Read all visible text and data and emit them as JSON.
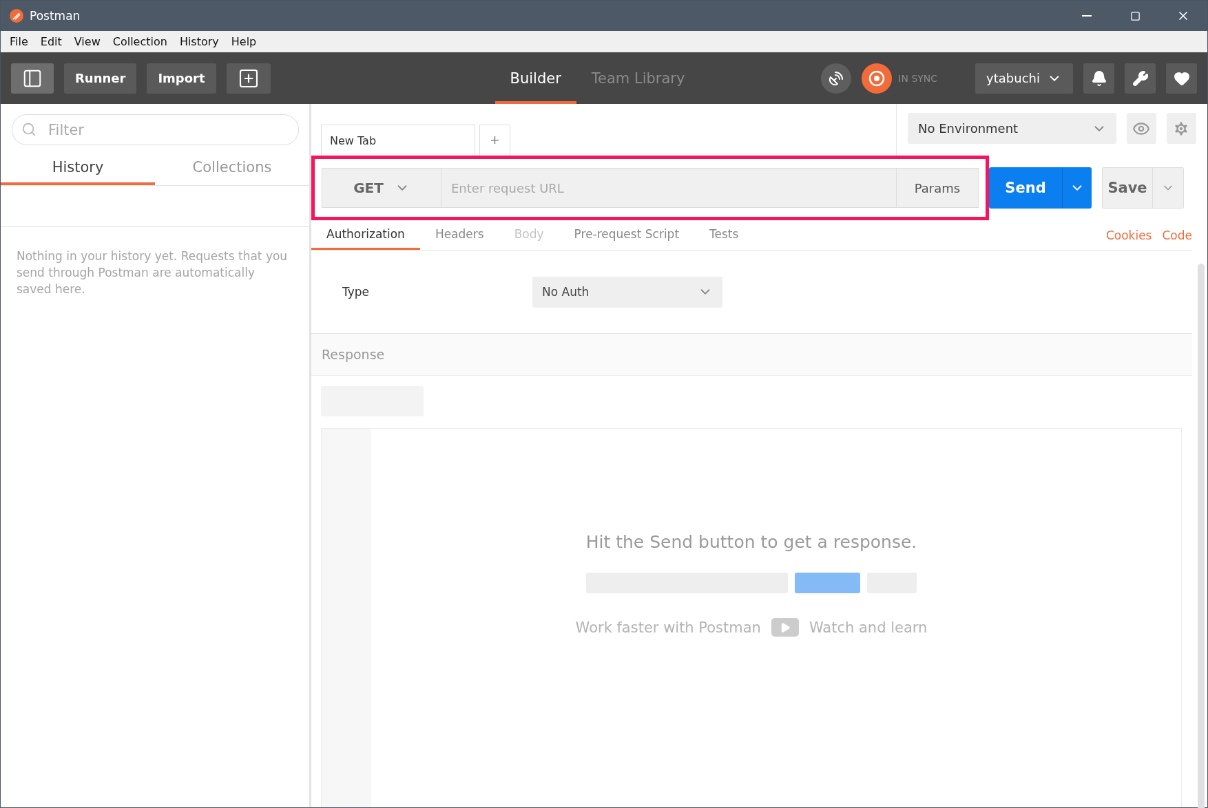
{
  "window": {
    "title": "Postman"
  },
  "menu": [
    "File",
    "Edit",
    "View",
    "Collection",
    "History",
    "Help"
  ],
  "toolbar": {
    "buttons": [
      "Runner",
      "Import"
    ],
    "nav_tabs": [
      {
        "label": "Builder",
        "selected": true
      },
      {
        "label": "Team Library",
        "selected": false
      }
    ],
    "sync_status": "IN SYNC",
    "user": "ytabuchi"
  },
  "sidebar": {
    "filter_placeholder": "Filter",
    "tabs": [
      {
        "label": "History",
        "selected": true
      },
      {
        "label": "Collections",
        "selected": false
      }
    ],
    "empty_message": "Nothing in your history yet. Requests that you send through Postman are automatically saved here."
  },
  "request_tabs": [
    {
      "label": "New Tab",
      "selected": true
    }
  ],
  "new_tab_button": "+",
  "environment": "No Environment",
  "request": {
    "method": "GET",
    "url_placeholder": "Enter request URL",
    "params": "Params",
    "highlighted": true
  },
  "send_button": "Send",
  "save_button": "Save",
  "request_sections": [
    {
      "label": "Authorization",
      "selected": true,
      "disabled": false
    },
    {
      "label": "Headers",
      "selected": false,
      "disabled": false
    },
    {
      "label": "Body",
      "selected": false,
      "disabled": true
    },
    {
      "label": "Pre-request Script",
      "selected": false,
      "disabled": false
    },
    {
      "label": "Tests",
      "selected": false,
      "disabled": false
    }
  ],
  "links": [
    "Cookies",
    "Code"
  ],
  "auth": {
    "label": "Type",
    "value": "No Auth"
  },
  "response": {
    "title": "Response",
    "message": "Hit the Send button to get a response.",
    "promo": "Work faster with Postman",
    "video_link": "Watch and learn"
  }
}
